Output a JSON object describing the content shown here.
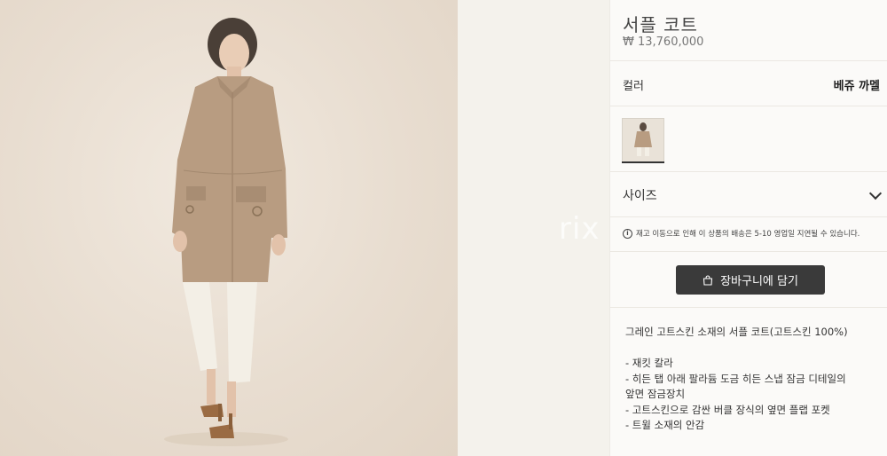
{
  "product": {
    "title": "서플 코트",
    "price": "₩ 13,760,000",
    "color_label": "컬러",
    "color_value": "베쥬 까멜",
    "size_label": "사이즈",
    "notice": "재고 이동으로 인해 이 상품의 배송은 5-10 영업일 지연될 수 있습니다.",
    "cart_button": "장바구니에 담기",
    "description_lead": "그레인 고트스킨 소재의 서플 코트(고트스킨 100%)",
    "features": [
      "- 재킷 칼라",
      "- 히든 탭 아래 팔라듐 도금 히든 스냅 잠금 디테일의",
      "앞면 잠금장치",
      "- 고트스킨으로 감싼 버클 장식의 옆면 플랩 포켓",
      "- 트윌 소재의 안감"
    ]
  },
  "watermark": "rix",
  "icons": {
    "info": "info-icon",
    "bag": "shopping-bag-icon",
    "chevron": "chevron-down-icon"
  },
  "colors": {
    "button_bg": "#3a3a3a",
    "coat": "#b89c81",
    "background": "#e8ddd0"
  }
}
